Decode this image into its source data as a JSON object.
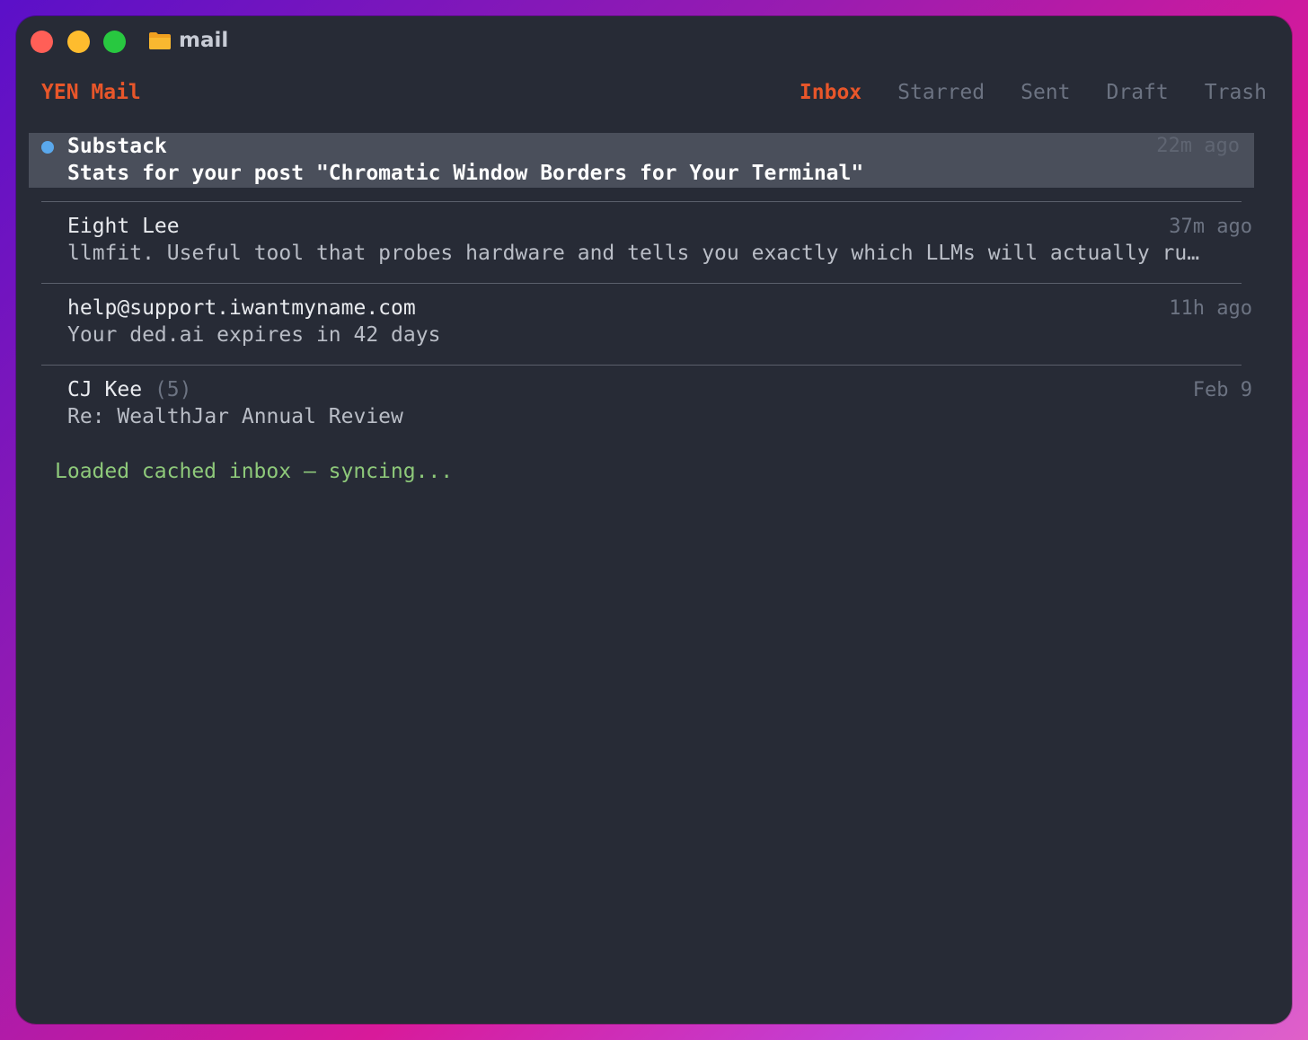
{
  "window": {
    "title": "mail"
  },
  "app": {
    "brand": "YEN Mail"
  },
  "tabs": [
    "Inbox",
    "Starred",
    "Sent",
    "Draft",
    "Trash"
  ],
  "active_tab": "Inbox",
  "emails": [
    {
      "sender": "Substack",
      "count": "",
      "subject": "Stats for your post \"Chromatic Window Borders for Your Terminal\"",
      "time": "22m ago",
      "unread": true,
      "selected": true
    },
    {
      "sender": "Eight Lee",
      "count": "",
      "subject": "llmfit. Useful tool that probes hardware and tells you exactly which LLMs will actually ru…",
      "time": "37m ago",
      "unread": false,
      "selected": false
    },
    {
      "sender": "help@support.iwantmyname.com",
      "count": "",
      "subject": "Your ded.ai expires in 42 days",
      "time": "11h ago",
      "unread": false,
      "selected": false
    },
    {
      "sender": "CJ Kee",
      "count": "(5)",
      "subject": "Re: WealthJar Annual Review",
      "time": "Feb 9",
      "unread": false,
      "selected": false
    }
  ],
  "status": "Loaded cached inbox — syncing...",
  "colors": {
    "accent": "#e8562a",
    "unread_dot": "#5aa8ec",
    "status": "#8ec97a",
    "background": "#272b36"
  },
  "icons": {
    "folder": "folder-icon"
  }
}
